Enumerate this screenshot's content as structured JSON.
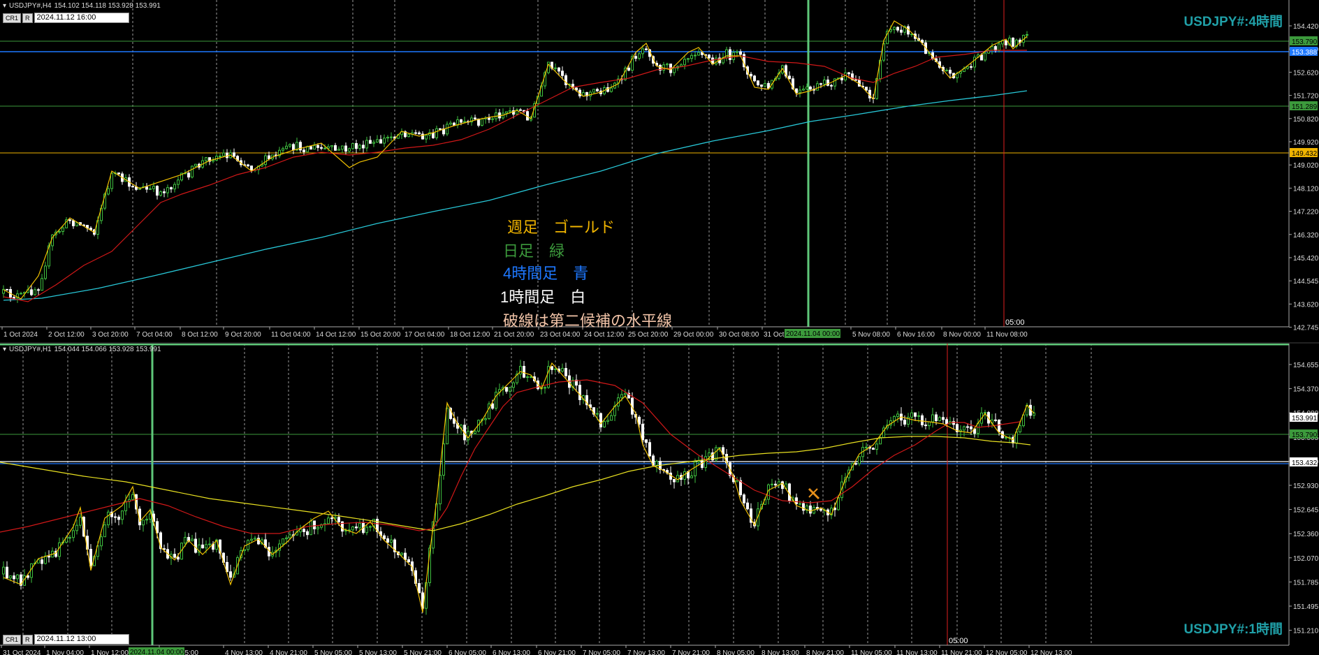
{
  "colors": {
    "background": "#000000",
    "grid": "#9a9a9a",
    "gold": "#f0b400",
    "green": "#3c9a3c",
    "blue": "#1e78ff",
    "white": "#ffffff",
    "red_ma": "#d01818",
    "cyan_ma": "#28c8d8",
    "yellow_ma": "#e8e020",
    "zigzag": "#f0c000",
    "current_time": "#e02020",
    "period_sep": "#5fc87a",
    "title": "#20a0a8"
  },
  "top_chart": {
    "header": {
      "symbol": "USDJPY#,H4",
      "ohlc": "154.102 154.118 153.928 153.991"
    },
    "toolbar": {
      "button1": "CR1",
      "button2": "R",
      "date_value": "2024.11.12 16:00"
    },
    "title": "USDJPY#:4時間",
    "price_ticks": [
      "154.420",
      "153.530",
      "152.620",
      "151.720",
      "150.820",
      "149.920",
      "149.020",
      "148.120",
      "147.220",
      "146.320",
      "145.420",
      "144.545",
      "143.620",
      "142.745"
    ],
    "price_labels": [
      {
        "text": "153.790",
        "kind": "green"
      },
      {
        "text": "153.388",
        "kind": "blue"
      },
      {
        "text": "151.289",
        "kind": "green"
      },
      {
        "text": "149.432",
        "kind": "gold"
      }
    ],
    "time_ticks": [
      "1 Oct 2024",
      "2 Oct 12:00",
      "3 Oct 20:00",
      "7 Oct 04:00",
      "8 Oct 12:00",
      "9 Oct 20:00",
      "11 Oct 04:00",
      "14 Oct 12:00",
      "15 Oct 20:00",
      "17 Oct 04:00",
      "18 Oct 12:00",
      "21 Oct 20:00",
      "23 Oct 04:00",
      "24 Oct 12:00",
      "25 Oct 20:00",
      "29 Oct 00:00",
      "30 Oct 08:00",
      "31 Oct",
      "5 Nov 08:00",
      "6 Nov 16:00",
      "8 Nov 00:00",
      "11 Nov 08:00"
    ],
    "separator_label": "2024.11.04 00:00",
    "current_time_label": "05:00",
    "legend": [
      {
        "text": "週足　ゴールド",
        "color": "#f0b400"
      },
      {
        "text": "日足　緑",
        "color": "#3c9a3c"
      },
      {
        "text": "4時間足　青",
        "color": "#1e78ff"
      },
      {
        "text": "1時間足　白",
        "color": "#ffffff"
      },
      {
        "text": "破線は第二候補の水平線",
        "color": "#f2c4a8"
      }
    ]
  },
  "bottom_chart": {
    "header": {
      "symbol": "USDJPY#,H1",
      "ohlc": "154.044 154.066 153.928 153.991"
    },
    "toolbar": {
      "button1": "CR1",
      "button2": "R",
      "date_value": "2024.11.12 13:00"
    },
    "title": "USDJPY#:1時間",
    "price_ticks": [
      "154.655",
      "154.370",
      "154.080",
      "153.505",
      "153.220",
      "152.930",
      "152.645",
      "152.360",
      "152.070",
      "151.785",
      "151.495",
      "151.210"
    ],
    "price_labels": [
      {
        "text": "153.991",
        "kind": "white"
      },
      {
        "text": "153.790",
        "kind": "green"
      },
      {
        "text": "153.432",
        "kind": "white"
      }
    ],
    "time_ticks": [
      "31 Oct 2024",
      "1 Nov 04:00",
      "1 Nov 12:00",
      "4 Nov 05:00",
      "4 Nov 13:00",
      "4 Nov 21:00",
      "5 Nov 05:00",
      "5 Nov 13:00",
      "5 Nov 21:00",
      "6 Nov 05:00",
      "6 Nov 13:00",
      "6 Nov 21:00",
      "7 Nov 05:00",
      "7 Nov 13:00",
      "7 Nov 21:00",
      "8 Nov 05:00",
      "8 Nov 13:00",
      "8 Nov 21:00",
      "11 Nov 05:00",
      "11 Nov 13:00",
      "11 Nov 21:00",
      "12 Nov 05:00",
      "12 Nov 13:00"
    ],
    "separator_label": "2024.11.04 00:00",
    "current_time_label": "05:00"
  }
}
